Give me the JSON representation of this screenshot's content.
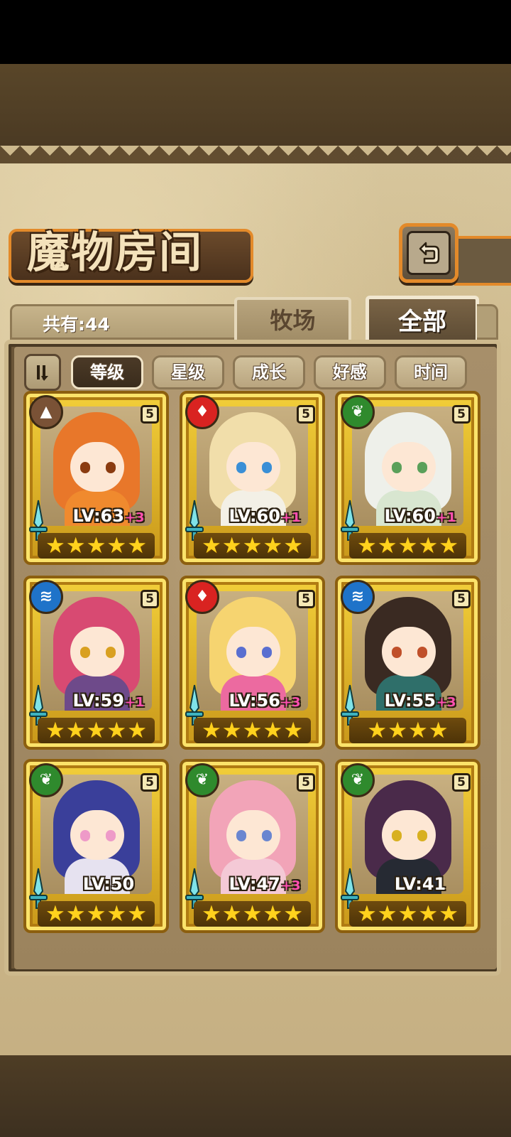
{
  "title": "魔物房间",
  "count_label": "共有:44",
  "tabs": [
    {
      "label": "牧场",
      "active": false
    },
    {
      "label": "全部",
      "active": true
    }
  ],
  "sort_filters": [
    {
      "label": "等级",
      "active": true
    },
    {
      "label": "星级",
      "active": false
    },
    {
      "label": "成长",
      "active": false
    },
    {
      "label": "好感",
      "active": false
    },
    {
      "label": "时间",
      "active": false
    }
  ],
  "icons": {
    "back": "back-arrow-icon",
    "sort_toggle": "sort-order-icon",
    "weapon": "sword-icon",
    "star": "★"
  },
  "element_colors": {
    "earth": "#7a5236",
    "fire": "#d92321",
    "nature": "#2f8a2d",
    "water": "#1f73c9"
  },
  "rarity_badge": "5",
  "monsters": [
    {
      "level": "LV:63",
      "bonus": "+3",
      "element": "earth",
      "stars": 5,
      "hair": "#e8772a",
      "body": "#f08a2e",
      "eyes": "#8a3b10"
    },
    {
      "level": "LV:60",
      "bonus": "+1",
      "element": "fire",
      "stars": 5,
      "hair": "#f1deaa",
      "body": "#f3f0e6",
      "eyes": "#3a8fd6"
    },
    {
      "level": "LV:60",
      "bonus": "+1",
      "element": "nature",
      "stars": 5,
      "hair": "#eef0ea",
      "body": "#d8e6d0",
      "eyes": "#5aa05a"
    },
    {
      "level": "LV:59",
      "bonus": "+1",
      "element": "water",
      "stars": 5,
      "hair": "#d84a72",
      "body": "#6e4a8a",
      "eyes": "#d9a020"
    },
    {
      "level": "LV:56",
      "bonus": "+3",
      "element": "fire",
      "stars": 5,
      "hair": "#f6d470",
      "body": "#ec6aa0",
      "eyes": "#5a6fd0"
    },
    {
      "level": "LV:55",
      "bonus": "+3",
      "element": "water",
      "stars": 4,
      "hair": "#3a2a22",
      "body": "#2f6f6a",
      "eyes": "#c0502a"
    },
    {
      "level": "LV:50",
      "bonus": "",
      "element": "nature",
      "stars": 5,
      "hair": "#3a3f9a",
      "body": "#e6e2f0",
      "eyes": "#ee9ac8"
    },
    {
      "level": "LV:47",
      "bonus": "+3",
      "element": "nature",
      "stars": 5,
      "hair": "#f2a4b8",
      "body": "#f4c9d6",
      "eyes": "#6a86d0"
    },
    {
      "level": "LV:41",
      "bonus": "",
      "element": "nature",
      "stars": 5,
      "hair": "#4a2a4a",
      "body": "#262a33",
      "eyes": "#d8b020"
    }
  ]
}
